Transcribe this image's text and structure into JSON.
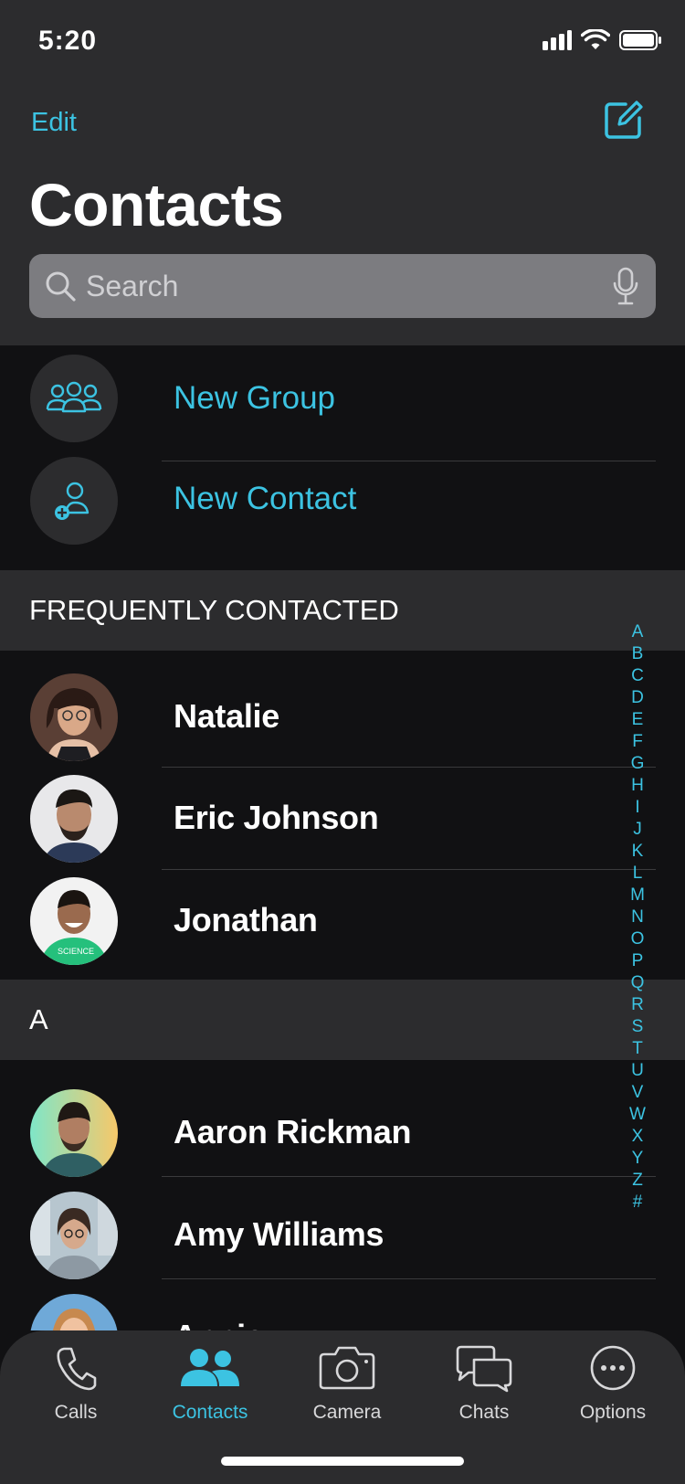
{
  "status": {
    "time": "5:20"
  },
  "header": {
    "edit_label": "Edit",
    "title": "Contacts",
    "search_placeholder": "Search"
  },
  "actions": [
    {
      "label": "New Group",
      "icon": "group-icon"
    },
    {
      "label": "New Contact",
      "icon": "add-contact-icon"
    }
  ],
  "sections": {
    "frequent": "FREQUENTLY CONTACTED",
    "a": "A"
  },
  "frequent_contacts": [
    {
      "name": "Natalie"
    },
    {
      "name": "Eric Johnson"
    },
    {
      "name": "Jonathan"
    }
  ],
  "a_contacts": [
    {
      "name": "Aaron Rickman"
    },
    {
      "name": "Amy Williams"
    },
    {
      "name": "Annie"
    }
  ],
  "alphabet_index": [
    "A",
    "B",
    "C",
    "D",
    "E",
    "F",
    "G",
    "H",
    "I",
    "J",
    "K",
    "L",
    "M",
    "N",
    "O",
    "P",
    "Q",
    "R",
    "S",
    "T",
    "U",
    "V",
    "W",
    "X",
    "Y",
    "Z",
    "#"
  ],
  "tabs": [
    {
      "label": "Calls",
      "icon": "phone-icon",
      "active": false
    },
    {
      "label": "Contacts",
      "icon": "contacts-icon",
      "active": true
    },
    {
      "label": "Camera",
      "icon": "camera-icon",
      "active": false
    },
    {
      "label": "Chats",
      "icon": "chat-bubbles-icon",
      "active": false
    },
    {
      "label": "Options",
      "icon": "more-options-icon",
      "active": false
    }
  ],
  "colors": {
    "accent": "#3cc3e2",
    "background": "#111113",
    "surface": "#2c2c2e",
    "search_field": "#7c7c80"
  }
}
